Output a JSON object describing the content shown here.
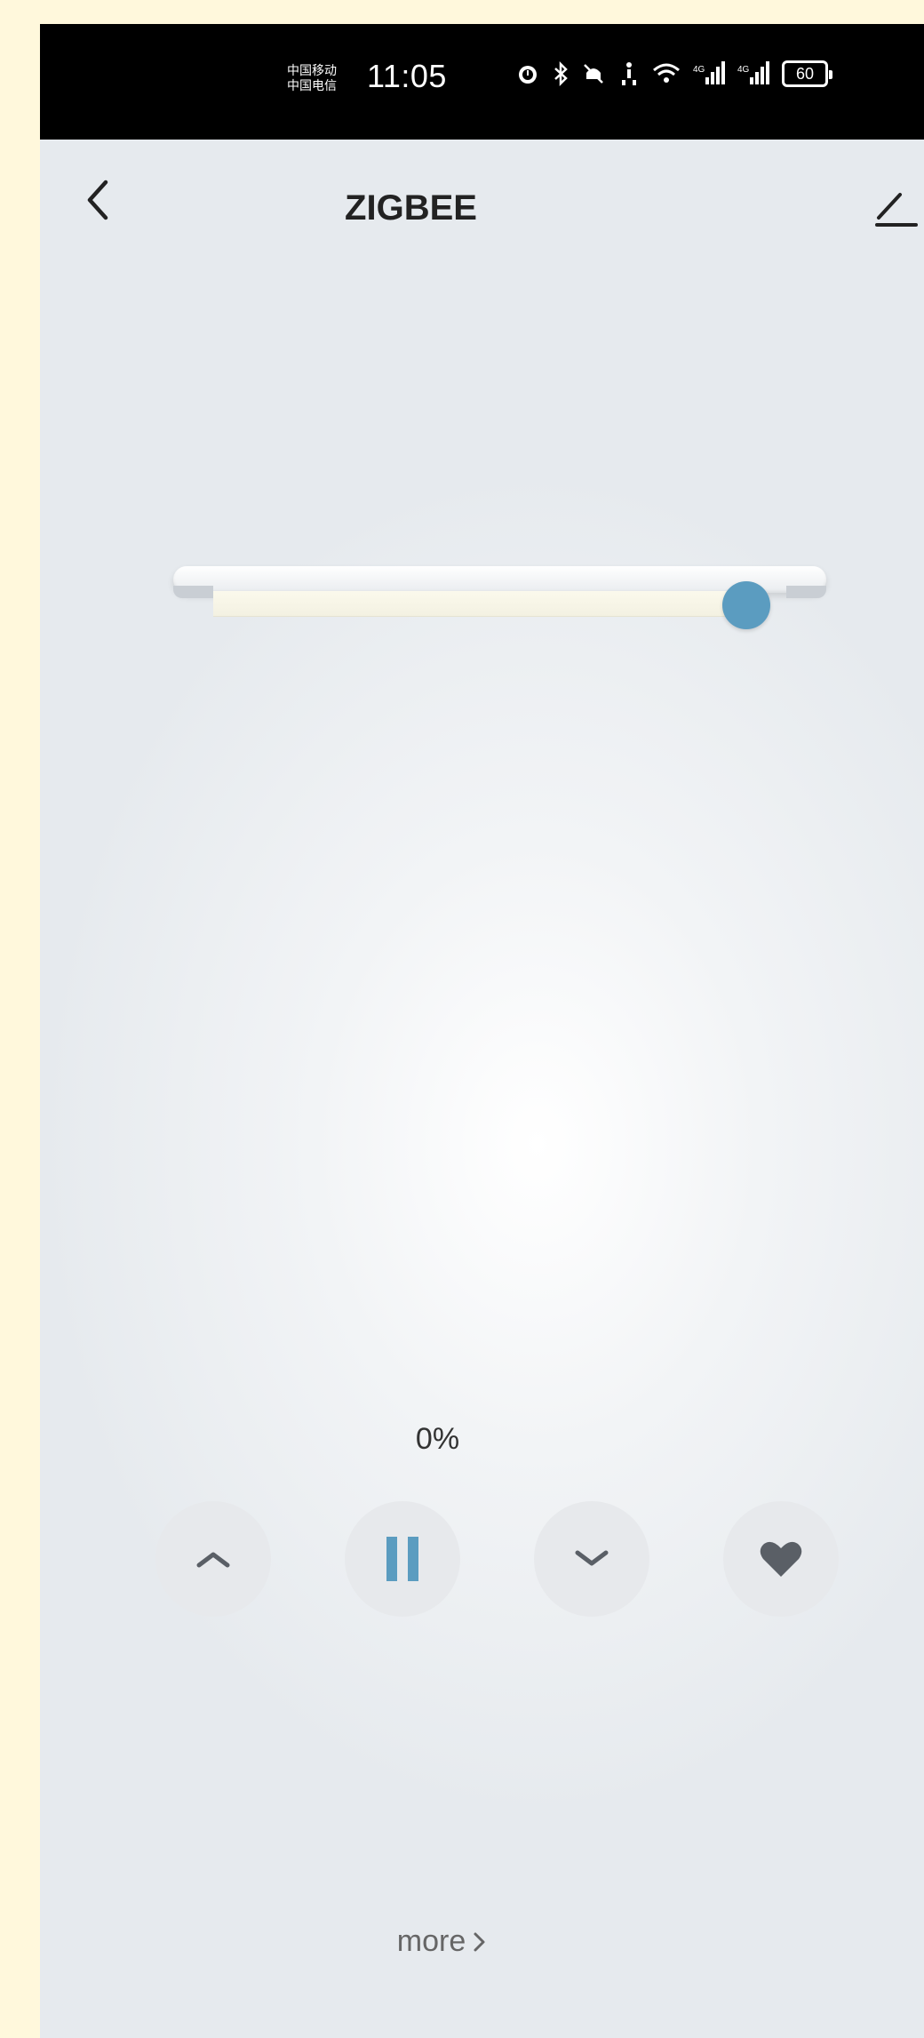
{
  "status_bar": {
    "carrier_1": "中国移动",
    "carrier_2": "中国电信",
    "time": "11:05",
    "battery": "60"
  },
  "header": {
    "title": "ZIGBEE"
  },
  "curtain": {
    "position_fraction": 0.93
  },
  "percent_label": "0%",
  "more_label": "more",
  "colors": {
    "accent": "#5b9cc0",
    "icon_gray": "#5a5f66"
  }
}
